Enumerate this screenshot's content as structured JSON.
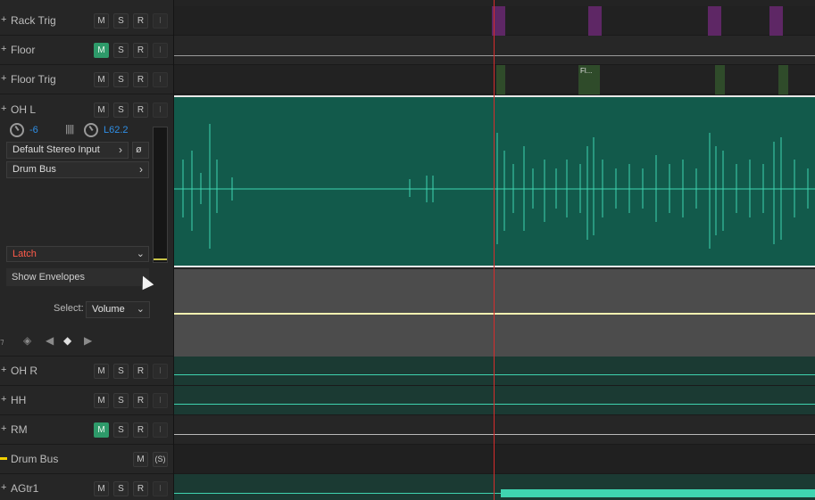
{
  "tracks": [
    {
      "name": "Rack Trig",
      "mute_active": false
    },
    {
      "name": "Floor",
      "mute_active": true
    },
    {
      "name": "Floor Trig",
      "mute_active": false
    },
    {
      "name": "OH L",
      "mute_active": false
    },
    {
      "name": "OH R",
      "mute_active": false
    },
    {
      "name": "HH",
      "mute_active": false
    },
    {
      "name": "RM",
      "mute_active": true
    },
    {
      "name": "Drum Bus",
      "mute_active": false
    },
    {
      "name": "AGtr1",
      "mute_active": false
    }
  ],
  "button_labels": {
    "mute": "M",
    "solo": "S",
    "record": "R",
    "input": "I",
    "solo_bus": "(S)"
  },
  "ohl": {
    "volume_value": "-6",
    "pan_value": "L62.2",
    "input": "Default Stereo Input",
    "output": "Drum Bus",
    "automation_mode": "Latch",
    "show_envelopes": "Show Envelopes",
    "select_label": "Select:",
    "select_value": "Volume"
  },
  "floor_trig_clip_label": "Fl...",
  "colors": {
    "waveform": "#3fd4b0",
    "clip_purple": "#c73bd1",
    "clip_green": "#2e9a6a",
    "mute_on": "#2e9a6a",
    "playhead": "#d62c2c",
    "latch": "#ff5b4a",
    "envelope_line": "#f4f1b1",
    "bus_icon": "#f1d000"
  },
  "icons": {
    "expander": "plus-icon",
    "volume_knob": "knob-icon",
    "phase": "phase-invert-icon",
    "chevron": "chevron-right-icon",
    "dropdown": "chevron-down-icon",
    "keyframe_tools": [
      "keyframe-clear-icon",
      "prev-keyframe-icon",
      "add-keyframe-icon",
      "next-keyframe-icon"
    ]
  }
}
